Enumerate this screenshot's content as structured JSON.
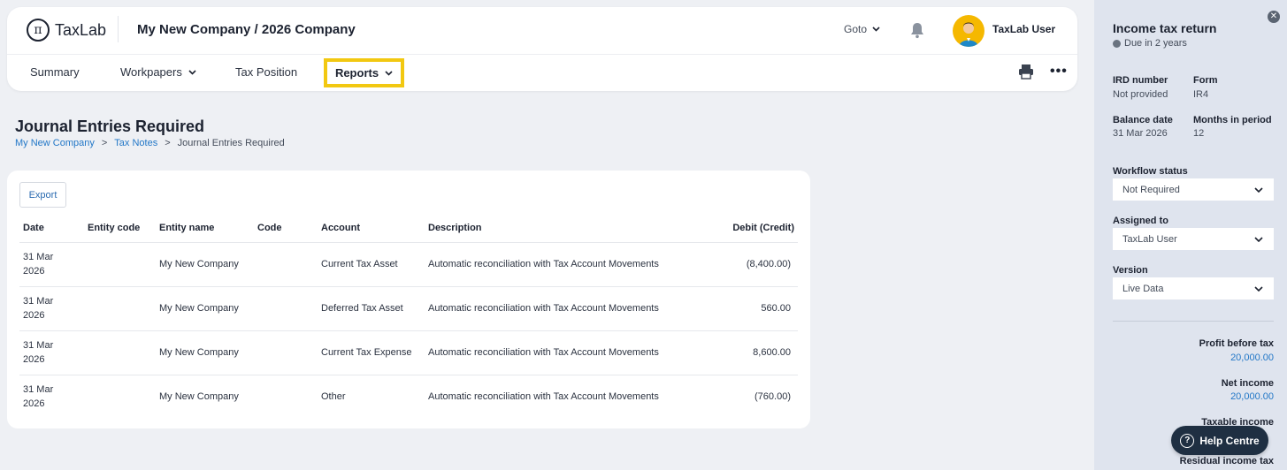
{
  "header": {
    "logo_text": "TaxLab",
    "company": "My New Company / 2026 Company",
    "goto_label": "Goto",
    "user_name": "TaxLab User"
  },
  "tabs": [
    {
      "label": "Summary"
    },
    {
      "label": "Workpapers"
    },
    {
      "label": "Tax Position"
    },
    {
      "label": "Reports"
    }
  ],
  "page": {
    "title": "Journal Entries Required",
    "breadcrumb": [
      "My New Company",
      "Tax Notes",
      "Journal Entries Required"
    ],
    "export_label": "Export"
  },
  "table": {
    "columns": [
      "Date",
      "Entity code",
      "Entity name",
      "Code",
      "Account",
      "Description",
      "Debit (Credit)"
    ],
    "rows": [
      {
        "date_line1": "31 Mar",
        "date_line2": "2026",
        "entity_code": "",
        "entity_name": "My New Company",
        "code": "",
        "account": "Current Tax Asset",
        "description": "Automatic reconciliation with Tax Account Movements",
        "amount": "(8,400.00)"
      },
      {
        "date_line1": "31 Mar",
        "date_line2": "2026",
        "entity_code": "",
        "entity_name": "My New Company",
        "code": "",
        "account": "Deferred Tax Asset",
        "description": "Automatic reconciliation with Tax Account Movements",
        "amount": "560.00"
      },
      {
        "date_line1": "31 Mar",
        "date_line2": "2026",
        "entity_code": "",
        "entity_name": "My New Company",
        "code": "",
        "account": "Current Tax Expense",
        "description": "Automatic reconciliation with Tax Account Movements",
        "amount": "8,600.00"
      },
      {
        "date_line1": "31 Mar",
        "date_line2": "2026",
        "entity_code": "",
        "entity_name": "My New Company",
        "code": "",
        "account": "Other",
        "description": "Automatic reconciliation with Tax Account Movements",
        "amount": "(760.00)"
      }
    ]
  },
  "side": {
    "title": "Income tax return",
    "due": "Due in 2 years",
    "ird_label": "IRD number",
    "ird_value": "Not provided",
    "form_label": "Form",
    "form_value": "IR4",
    "balance_label": "Balance date",
    "balance_value": "31 Mar 2026",
    "months_label": "Months in period",
    "months_value": "12",
    "workflow_label": "Workflow status",
    "workflow_value": "Not Required",
    "assigned_label": "Assigned to",
    "assigned_value": "TaxLab User",
    "version_label": "Version",
    "version_value": "Live Data",
    "profit_label": "Profit before tax",
    "profit_value": "20,000.00",
    "net_label": "Net income",
    "net_value": "20,000.00",
    "taxable_label": "Taxable income",
    "residual_label": "Residual income tax"
  },
  "help_label": "Help Centre",
  "colors": {
    "accent": "#2277c7",
    "highlight": "#f2c811",
    "help_bg": "#1f2f42"
  }
}
